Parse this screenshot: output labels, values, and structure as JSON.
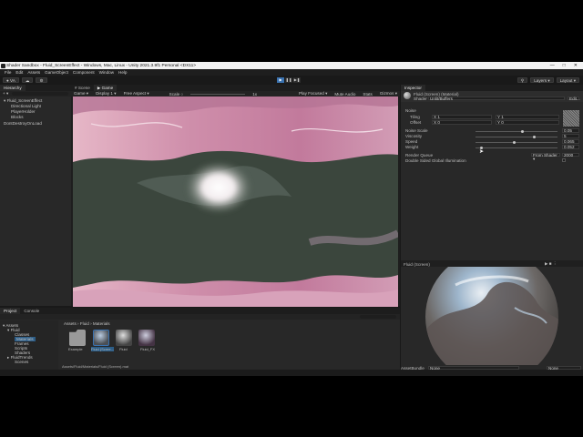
{
  "window": {
    "title": "Shader Sandbox - Fluid_ScreenEffect - Windows, Mac, Linux - Unity 2021.3.9f1 Personal <DX11>"
  },
  "menu": [
    "File",
    "Edit",
    "Assets",
    "GameObject",
    "Component",
    "Window",
    "Help"
  ],
  "toolbar": {
    "left": [
      "● VA",
      "☁",
      "⚙"
    ],
    "right": [
      "Layers ▾",
      "Layout ▾"
    ]
  },
  "hierarchy": {
    "tab": "Hierarchy",
    "items": [
      "▾ Fluid_ScreenEffect",
      "Directional Light",
      "PlayerHolder",
      "Blocks",
      "DontDestroyOnLoad"
    ]
  },
  "scene": {
    "tabs": [
      "# Scene",
      "▶ Game"
    ],
    "game_bar": [
      "Game ▾",
      "Display 1 ▾",
      "Free Aspect ▾",
      "Scale ○",
      "1x",
      "Play Focused ▾",
      "Mute Audio",
      "Stats",
      "Gizmos ▾"
    ]
  },
  "inspector": {
    "tab": "Inspector",
    "material_name": "Fluid (Screen) (Material)",
    "shader_label": "Shader",
    "shader_value": "Unlit/Buffers",
    "edit_label": "Edit...",
    "noise_label": "Noise",
    "tiling_label": "Tiling",
    "offset_label": "Offset",
    "tiling": {
      "x": "X  1",
      "y": "Y  1"
    },
    "offset": {
      "x": "X  0",
      "y": "Y  0"
    },
    "select_label": "Select",
    "props": [
      {
        "label": "Noise Scale",
        "value": "0.05",
        "level": 0.55
      },
      {
        "label": "Viscosity",
        "value": "5",
        "level": 0.7
      },
      {
        "label": "Speed",
        "value": "0.065",
        "level": 0.45
      },
      {
        "label": "Weight",
        "value": "0.052",
        "level": 0.05
      }
    ],
    "render_queue_label": "Render Queue",
    "render_queue_mode": "From Shader ▾",
    "render_queue_value": "2000",
    "double_sided_label": "Double Sided Global Illumination",
    "preview_label": "Fluid (Screen)",
    "assetbundle_label": "AssetBundle",
    "assetbundle_value": "None",
    "assetbundle_variant": "None"
  },
  "project": {
    "tabs": [
      "Project",
      "Console"
    ],
    "tree": [
      "▾ Assets",
      "▾ Fluid",
      "Classes",
      "Materials",
      "Frames",
      "Scripts",
      "Shaders",
      "▸ FluidTrends",
      "Scenes"
    ],
    "breadcrumb": "Assets › Fluid › Materials",
    "assets": [
      "Example",
      "Fluid (Scree...",
      "Fluid",
      "Fluid_FX"
    ],
    "path": "Assets/Fluid/Materials/Fluid (Screen).mat"
  },
  "colors": {
    "accent": "#3a72b0",
    "pink": "#d9a9bd",
    "dark_green": "#3a453c"
  }
}
